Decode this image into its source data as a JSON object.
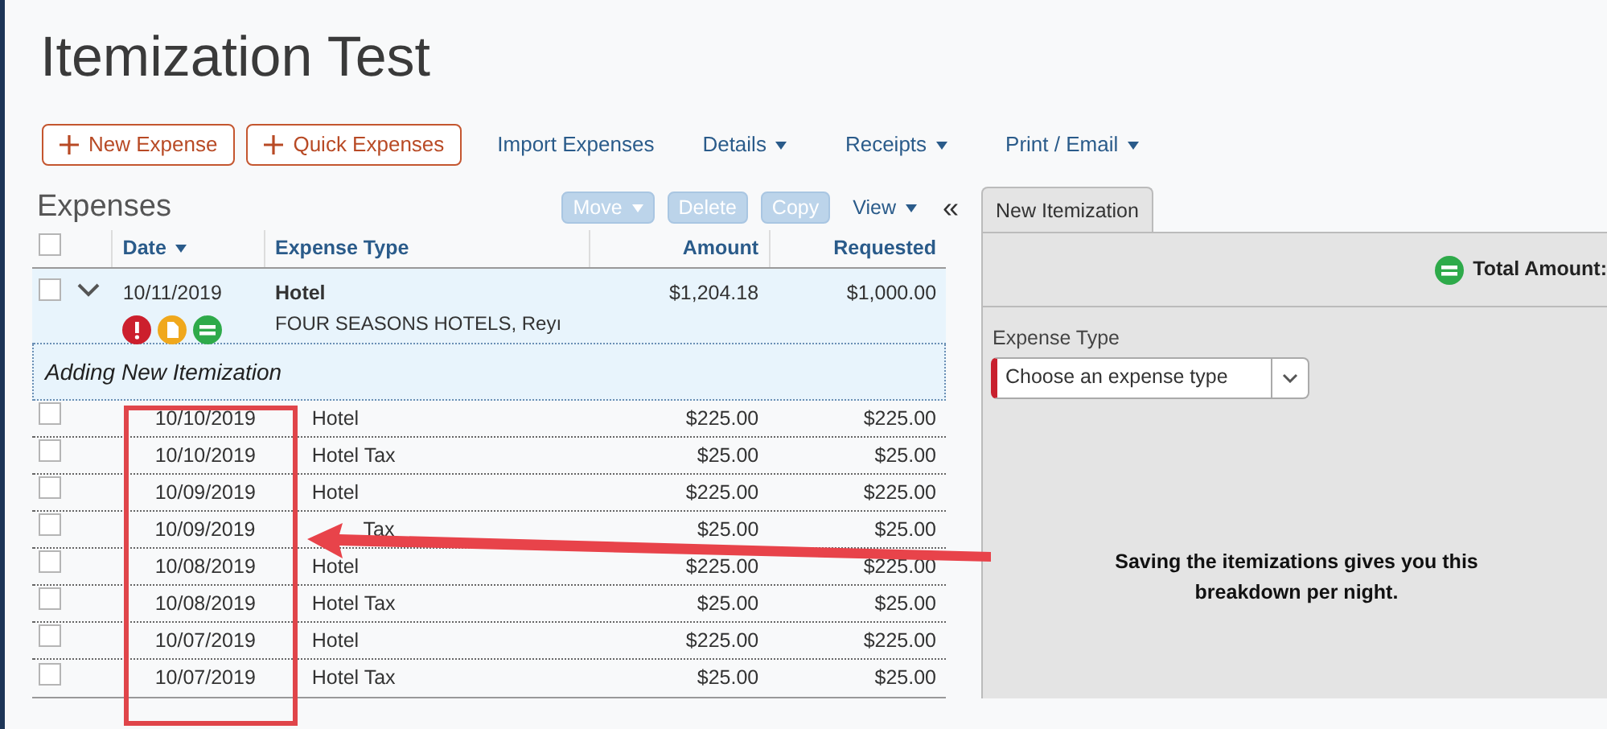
{
  "title": "Itemization Test",
  "actions": [
    {
      "label": "New Expense",
      "kind": "primary"
    },
    {
      "label": "Quick Expenses",
      "kind": "primary"
    },
    {
      "label": "Import Expenses",
      "kind": "link"
    },
    {
      "label": "Details",
      "kind": "menu"
    },
    {
      "label": "Receipts",
      "kind": "menu"
    },
    {
      "label": "Print / Email",
      "kind": "menu"
    }
  ],
  "expenses": {
    "heading": "Expenses",
    "toolbar": [
      {
        "label": "Move",
        "kind": "menu",
        "disabled": true
      },
      {
        "label": "Delete",
        "kind": "button",
        "disabled": true
      },
      {
        "label": "Copy",
        "kind": "button",
        "disabled": true
      },
      {
        "label": "View",
        "kind": "menu",
        "disabled": false
      }
    ],
    "collapse": "«",
    "select_all": {
      "checked": false
    },
    "columns": [
      {
        "label": "Date",
        "sorted": true
      },
      {
        "label": "Expense Type",
        "sorted": false
      },
      {
        "label": "Amount",
        "sorted": false
      },
      {
        "label": "Requested",
        "sorted": false
      }
    ],
    "parent": {
      "checked": false,
      "expanded": true,
      "date": "10/11/2019",
      "type": "Hotel",
      "vendor": "FOUR SEASONS HOTELS, Reyı",
      "amount": "$1,204.18",
      "requested": "$1,000.00",
      "alerts": [
        {
          "kind": "exception",
          "color": "#cc1f2d"
        },
        {
          "kind": "receipt",
          "color": "#f0a81c"
        },
        {
          "kind": "itemized",
          "color": "#2eaa4a"
        }
      ]
    },
    "adding": "Adding New Itemization",
    "rows": [
      {
        "checked": false,
        "date": "10/10/2019",
        "type": "Hotel",
        "amount": "$225.00",
        "requested": "$225.00"
      },
      {
        "checked": false,
        "date": "10/10/2019",
        "type": "Hotel Tax",
        "amount": "$25.00",
        "requested": "$25.00"
      },
      {
        "checked": false,
        "date": "10/09/2019",
        "type": "Hotel",
        "amount": "$225.00",
        "requested": "$225.00"
      },
      {
        "checked": false,
        "date": "10/09/2019",
        "type": "Tax",
        "kind": "covered",
        "amount": "$25.00",
        "requested": "$25.00"
      },
      {
        "checked": false,
        "date": "10/08/2019",
        "type": "Hotel",
        "amount": "$225.00",
        "requested": "$225.00"
      },
      {
        "checked": false,
        "date": "10/08/2019",
        "type": "Hotel Tax",
        "amount": "$25.00",
        "requested": "$25.00"
      },
      {
        "checked": false,
        "date": "10/07/2019",
        "type": "Hotel",
        "amount": "$225.00",
        "requested": "$225.00"
      },
      {
        "checked": false,
        "date": "10/07/2019",
        "type": "Hotel Tax",
        "amount": "$25.00",
        "requested": "$25.00"
      }
    ]
  },
  "itemization": {
    "tab": {
      "label": "New Itemization",
      "selected": true
    },
    "total_label": "Total Amount:",
    "field_label": "Expense Type",
    "placeholder": "Choose an expense type",
    "required": true
  },
  "annotation": "Saving the itemizations gives you this breakdown per night."
}
